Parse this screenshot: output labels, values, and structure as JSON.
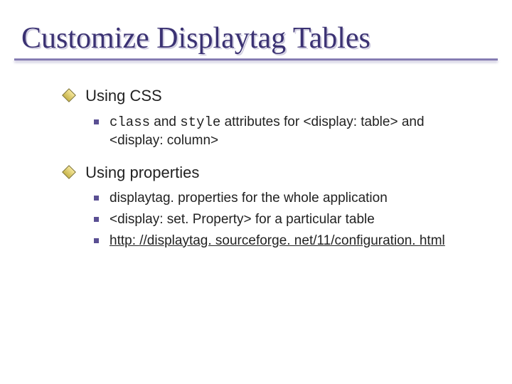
{
  "title": "Customize Displaytag Tables",
  "sections": [
    {
      "heading": "Using CSS",
      "items": [
        {
          "parts": [
            {
              "text": "class",
              "mono": true
            },
            {
              "text": " and "
            },
            {
              "text": "style",
              "mono": true
            },
            {
              "text": " attributes for <display: table> and <display: column>"
            }
          ]
        }
      ]
    },
    {
      "heading": "Using properties",
      "items": [
        {
          "parts": [
            {
              "text": "displaytag. properties for the whole application"
            }
          ]
        },
        {
          "parts": [
            {
              "text": "<display: set. Property> for a particular table"
            }
          ]
        },
        {
          "parts": [
            {
              "text": "http: //displaytag. sourceforge. net/11/configuration. html",
              "link": true
            }
          ]
        }
      ]
    }
  ]
}
